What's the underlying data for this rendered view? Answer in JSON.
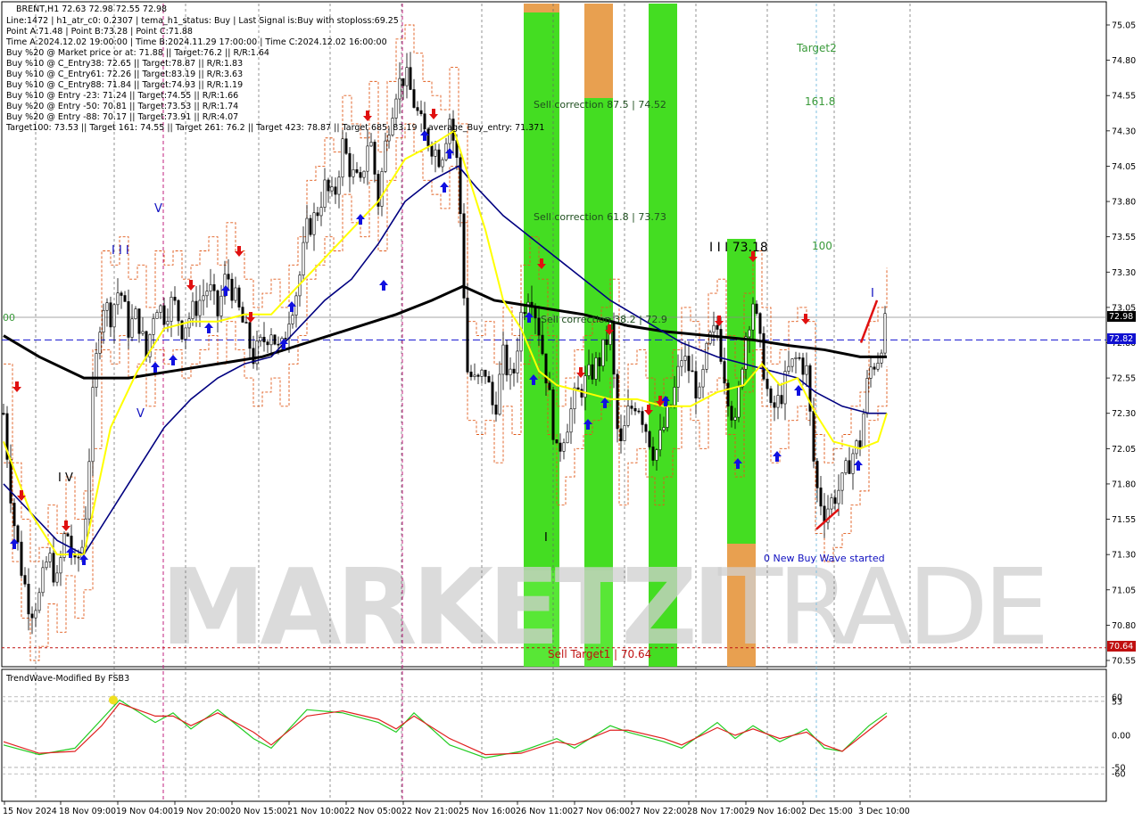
{
  "header": {
    "symbol_line": "BRENT,H1  72.63 72.98 72.55 72.98",
    "info_lines": [
      "Line:1472  |  h1_atr_c0: 0.2307  |  tema_h1_status: Buy  |  Last Signal is:Buy with stoploss:69.25",
      "Point A:71.48  |  Point B:73.28  |  Point C:71.88",
      "Time A:2024.12.02 19:00:00  |  Time B:2024.11.29 17:00:00  |  Time C:2024.12.02 16:00:00",
      "Buy %20 @ Market price or at: 71.88  ||  Target:76.2  ||  R/R:1.64",
      "Buy %10 @ C_Entry38: 72.65  ||  Target:78.87  ||  R/R:1.83",
      "Buy %10 @ C_Entry61: 72.26  ||  Target:83.19  ||  R/R:3.63",
      "Buy %10 @ C_Entry88: 71.84  ||  Target:74.93  ||  R/R:1.19",
      "Buy %10 @ Entry -23: 71.24  ||  Target:74.55  ||  R/R:1.66",
      "Buy %20 @ Entry -50: 70.81  ||  Target:73.53  ||  R/R:1.74",
      "Buy %20 @ Entry -88: 70.17  ||  Target:73.91  ||  R/R:4.07",
      "Target100: 73.53  ||  Target 161: 74.55  ||  Target 261: 76.2  ||  Target 423: 78.87  ||  Target 685: 83.19  ||  average_Buy_entry: 71.371"
    ]
  },
  "annotations": {
    "sell_correction_875": "Sell correction 87.5 | 74.52",
    "sell_correction_618": "Sell correction 61.8 | 73.73",
    "sell_correction_382": "Sell correction 38.2 | 72.9",
    "sell_target1": "Sell Target1 | 70.64",
    "target2": "Target2",
    "fib_1618": "161.8",
    "fib_100": "100",
    "wave_label": "I I I 73.18",
    "new_buy_wave": "0 New Buy Wave started",
    "wave_III_left": "I I I",
    "wave_IV": "I V",
    "wave_V_mark": "V",
    "wave_V_mark2": "V",
    "wave_I_mark": "I",
    "wave_I_mark2": "I",
    "left_00": "00"
  },
  "price_axis": {
    "ticks": [
      "75.05",
      "74.80",
      "74.55",
      "74.30",
      "74.05",
      "73.80",
      "73.55",
      "73.30",
      "73.05",
      "72.80",
      "72.55",
      "72.30",
      "72.05",
      "71.80",
      "71.55",
      "71.30",
      "71.05",
      "70.80",
      "70.55"
    ],
    "current_price": "72.98",
    "blue_level": "72.82",
    "red_level": "70.64"
  },
  "oscillator": {
    "title": "TrendWave-Modified By FSB3",
    "ticks": [
      "60",
      "53",
      "0.00",
      "-50",
      "-60"
    ]
  },
  "time_axis": {
    "labels": [
      "15 Nov 2024",
      "18 Nov 09:00",
      "19 Nov 04:00",
      "19 Nov 20:00",
      "20 Nov 15:00",
      "21 Nov 10:00",
      "22 Nov 05:00",
      "22 Nov 21:00",
      "25 Nov 16:00",
      "26 Nov 11:00",
      "27 Nov 06:00",
      "27 Nov 22:00",
      "28 Nov 17:00",
      "29 Nov 16:00",
      "2 Dec 15:00",
      "3 Dec 10:00"
    ]
  },
  "watermark": {
    "left": "MARKETZI",
    "right": "TRADE"
  },
  "colors": {
    "up_arrow": "#1010e0",
    "down_arrow": "#e01010",
    "ma_black": "#000000",
    "ma_navy": "#000080",
    "ma_yellow": "#ffff00",
    "green_zone": "#44dd22",
    "orange_zone": "#e8a050"
  },
  "chart_data": {
    "type": "candlestick",
    "symbol": "BRENT",
    "timeframe": "H1",
    "last_bar": {
      "open": 72.63,
      "high": 72.98,
      "low": 72.55,
      "close": 72.98
    },
    "price_range": [
      70.55,
      75.05
    ],
    "close_path": [
      [
        0,
        72.3
      ],
      [
        10,
        71.6
      ],
      [
        20,
        71.2
      ],
      [
        30,
        70.9
      ],
      [
        40,
        71.0
      ],
      [
        50,
        71.3
      ],
      [
        60,
        71.1
      ],
      [
        70,
        71.5
      ],
      [
        80,
        71.2
      ],
      [
        90,
        71.4
      ],
      [
        100,
        72.4
      ],
      [
        110,
        73.1
      ],
      [
        120,
        73.0
      ],
      [
        130,
        73.2
      ],
      [
        140,
        72.9
      ],
      [
        150,
        73.0
      ],
      [
        160,
        72.7
      ],
      [
        170,
        73.1
      ],
      [
        180,
        73.0
      ],
      [
        190,
        73.1
      ],
      [
        200,
        72.9
      ],
      [
        210,
        73.0
      ],
      [
        220,
        73.1
      ],
      [
        230,
        73.2
      ],
      [
        240,
        73.0
      ],
      [
        250,
        73.3
      ],
      [
        260,
        73.1
      ],
      [
        270,
        72.9
      ],
      [
        280,
        72.7
      ],
      [
        290,
        72.8
      ],
      [
        300,
        72.9
      ],
      [
        310,
        72.7
      ],
      [
        320,
        73.0
      ],
      [
        330,
        73.2
      ],
      [
        340,
        73.6
      ],
      [
        350,
        73.7
      ],
      [
        360,
        73.9
      ],
      [
        370,
        73.8
      ],
      [
        380,
        74.2
      ],
      [
        390,
        74.0
      ],
      [
        400,
        73.9
      ],
      [
        410,
        74.3
      ],
      [
        420,
        73.8
      ],
      [
        430,
        74.3
      ],
      [
        440,
        74.6
      ],
      [
        450,
        74.7
      ],
      [
        460,
        74.5
      ],
      [
        470,
        74.3
      ],
      [
        480,
        74.2
      ],
      [
        490,
        74.1
      ],
      [
        500,
        74.4
      ],
      [
        510,
        74.0
      ],
      [
        520,
        72.6
      ],
      [
        530,
        72.5
      ],
      [
        540,
        72.6
      ],
      [
        550,
        72.3
      ],
      [
        560,
        72.7
      ],
      [
        570,
        72.5
      ],
      [
        580,
        73.0
      ],
      [
        590,
        73.2
      ],
      [
        600,
        72.9
      ],
      [
        610,
        72.5
      ],
      [
        620,
        72.0
      ],
      [
        630,
        72.2
      ],
      [
        640,
        72.4
      ],
      [
        650,
        72.5
      ],
      [
        660,
        72.6
      ],
      [
        670,
        72.7
      ],
      [
        680,
        72.9
      ],
      [
        690,
        72.0
      ],
      [
        700,
        72.3
      ],
      [
        710,
        72.4
      ],
      [
        720,
        72.2
      ],
      [
        730,
        72.0
      ],
      [
        740,
        72.2
      ],
      [
        750,
        72.4
      ],
      [
        760,
        72.7
      ],
      [
        770,
        72.6
      ],
      [
        780,
        72.4
      ],
      [
        790,
        72.8
      ],
      [
        800,
        72.9
      ],
      [
        810,
        72.5
      ],
      [
        820,
        72.2
      ],
      [
        830,
        72.8
      ],
      [
        840,
        73.1
      ],
      [
        850,
        72.7
      ],
      [
        860,
        72.3
      ],
      [
        870,
        72.4
      ],
      [
        880,
        72.6
      ],
      [
        890,
        72.7
      ],
      [
        900,
        72.6
      ],
      [
        910,
        71.8
      ],
      [
        920,
        71.6
      ],
      [
        930,
        71.7
      ],
      [
        940,
        71.8
      ],
      [
        950,
        72.0
      ],
      [
        960,
        72.1
      ],
      [
        970,
        72.6
      ],
      [
        980,
        72.7
      ],
      [
        990,
        72.98
      ]
    ],
    "fast_line": [
      [
        0,
        72.1
      ],
      [
        30,
        71.6
      ],
      [
        60,
        71.3
      ],
      [
        90,
        71.3
      ],
      [
        120,
        72.2
      ],
      [
        150,
        72.6
      ],
      [
        180,
        72.9
      ],
      [
        210,
        72.95
      ],
      [
        240,
        72.95
      ],
      [
        270,
        73.0
      ],
      [
        300,
        73.0
      ],
      [
        330,
        73.2
      ],
      [
        360,
        73.4
      ],
      [
        390,
        73.6
      ],
      [
        420,
        73.8
      ],
      [
        450,
        74.1
      ],
      [
        480,
        74.2
      ],
      [
        505,
        74.3
      ],
      [
        520,
        74.0
      ],
      [
        540,
        73.6
      ],
      [
        560,
        73.1
      ],
      [
        580,
        72.9
      ],
      [
        600,
        72.6
      ],
      [
        620,
        72.5
      ],
      [
        650,
        72.45
      ],
      [
        680,
        72.4
      ],
      [
        710,
        72.4
      ],
      [
        740,
        72.35
      ],
      [
        770,
        72.35
      ],
      [
        800,
        72.45
      ],
      [
        830,
        72.5
      ],
      [
        850,
        72.65
      ],
      [
        870,
        72.5
      ],
      [
        890,
        72.55
      ],
      [
        910,
        72.3
      ],
      [
        930,
        72.1
      ],
      [
        960,
        72.05
      ],
      [
        980,
        72.1
      ],
      [
        990,
        72.3
      ]
    ],
    "mid_line": [
      [
        0,
        71.8
      ],
      [
        30,
        71.6
      ],
      [
        60,
        71.4
      ],
      [
        90,
        71.3
      ],
      [
        120,
        71.6
      ],
      [
        150,
        71.9
      ],
      [
        180,
        72.2
      ],
      [
        210,
        72.4
      ],
      [
        240,
        72.55
      ],
      [
        270,
        72.65
      ],
      [
        300,
        72.7
      ],
      [
        330,
        72.9
      ],
      [
        360,
        73.1
      ],
      [
        390,
        73.25
      ],
      [
        420,
        73.5
      ],
      [
        450,
        73.8
      ],
      [
        480,
        73.95
      ],
      [
        510,
        74.05
      ],
      [
        530,
        73.9
      ],
      [
        560,
        73.7
      ],
      [
        600,
        73.5
      ],
      [
        640,
        73.3
      ],
      [
        680,
        73.1
      ],
      [
        720,
        72.95
      ],
      [
        760,
        72.8
      ],
      [
        800,
        72.7
      ],
      [
        830,
        72.65
      ],
      [
        860,
        72.6
      ],
      [
        890,
        72.55
      ],
      [
        910,
        72.45
      ],
      [
        940,
        72.35
      ],
      [
        970,
        72.3
      ],
      [
        990,
        72.3
      ]
    ],
    "slow_line": [
      [
        0,
        72.85
      ],
      [
        40,
        72.7
      ],
      [
        90,
        72.55
      ],
      [
        140,
        72.55
      ],
      [
        190,
        72.6
      ],
      [
        240,
        72.65
      ],
      [
        290,
        72.7
      ],
      [
        340,
        72.8
      ],
      [
        390,
        72.9
      ],
      [
        440,
        73.0
      ],
      [
        480,
        73.1
      ],
      [
        515,
        73.2
      ],
      [
        550,
        73.1
      ],
      [
        600,
        73.05
      ],
      [
        650,
        73.0
      ],
      [
        700,
        72.92
      ],
      [
        740,
        72.88
      ],
      [
        790,
        72.85
      ],
      [
        840,
        72.82
      ],
      [
        880,
        72.78
      ],
      [
        920,
        72.75
      ],
      [
        960,
        72.7
      ],
      [
        990,
        72.7
      ]
    ],
    "osc_fast": [
      [
        0,
        -15
      ],
      [
        40,
        -30
      ],
      [
        80,
        -20
      ],
      [
        110,
        25
      ],
      [
        130,
        55
      ],
      [
        170,
        20
      ],
      [
        190,
        35
      ],
      [
        210,
        10
      ],
      [
        240,
        40
      ],
      [
        280,
        -5
      ],
      [
        300,
        -20
      ],
      [
        340,
        40
      ],
      [
        380,
        35
      ],
      [
        420,
        20
      ],
      [
        440,
        5
      ],
      [
        460,
        35
      ],
      [
        500,
        -15
      ],
      [
        540,
        -35
      ],
      [
        580,
        -25
      ],
      [
        620,
        -5
      ],
      [
        640,
        -20
      ],
      [
        680,
        15
      ],
      [
        700,
        5
      ],
      [
        740,
        -10
      ],
      [
        760,
        -20
      ],
      [
        800,
        20
      ],
      [
        820,
        -5
      ],
      [
        840,
        15
      ],
      [
        870,
        -10
      ],
      [
        900,
        10
      ],
      [
        920,
        -20
      ],
      [
        940,
        -25
      ],
      [
        970,
        15
      ],
      [
        990,
        35
      ]
    ],
    "osc_slow": [
      [
        0,
        -10
      ],
      [
        40,
        -28
      ],
      [
        80,
        -25
      ],
      [
        110,
        15
      ],
      [
        130,
        50
      ],
      [
        170,
        30
      ],
      [
        190,
        30
      ],
      [
        210,
        15
      ],
      [
        240,
        35
      ],
      [
        280,
        5
      ],
      [
        300,
        -15
      ],
      [
        340,
        30
      ],
      [
        380,
        38
      ],
      [
        420,
        25
      ],
      [
        440,
        10
      ],
      [
        460,
        30
      ],
      [
        500,
        -5
      ],
      [
        540,
        -30
      ],
      [
        580,
        -28
      ],
      [
        620,
        -10
      ],
      [
        640,
        -15
      ],
      [
        680,
        8
      ],
      [
        700,
        8
      ],
      [
        740,
        -5
      ],
      [
        760,
        -15
      ],
      [
        800,
        12
      ],
      [
        820,
        0
      ],
      [
        840,
        10
      ],
      [
        870,
        -5
      ],
      [
        900,
        5
      ],
      [
        920,
        -15
      ],
      [
        940,
        -25
      ],
      [
        970,
        8
      ],
      [
        990,
        30
      ]
    ]
  }
}
